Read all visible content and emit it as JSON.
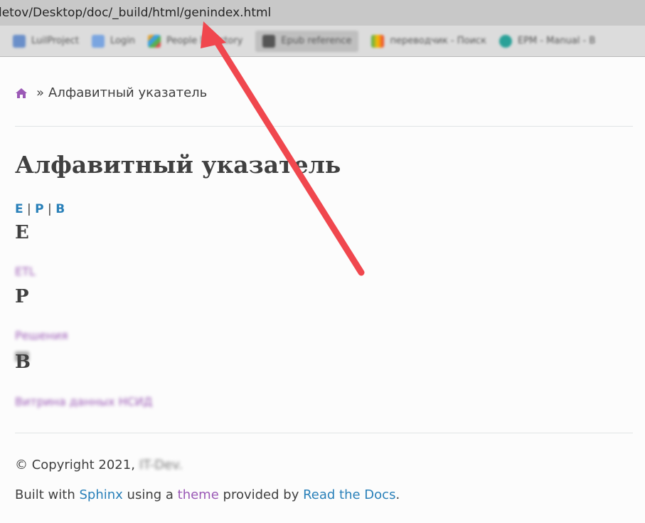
{
  "browser": {
    "url": "letov/Desktop/doc/_build/html/genindex.html",
    "bookmarks": [
      {
        "label": "LuilProject",
        "color": "#6a8fc9"
      },
      {
        "label": "Login",
        "color": "#7aa5e0"
      },
      {
        "label": "People Directory",
        "color": "#e0a030"
      },
      {
        "label": "Epub reference",
        "color": "#555555"
      },
      {
        "label": "переводчик - Поиск",
        "color": "#4caf50"
      },
      {
        "label": "EPM - Manual - B",
        "color": "#2aa198"
      }
    ]
  },
  "breadcrumb": {
    "home_icon": "home-icon",
    "separator": "»",
    "current": "Алфавитный указатель"
  },
  "page": {
    "title": "Алфавитный указатель",
    "jump_letters": [
      "Е",
      "Р",
      "В"
    ],
    "jump_separator": "|",
    "sections": [
      {
        "letter": "Е",
        "entry": "ETL"
      },
      {
        "letter": "Р",
        "entry": "Решения"
      },
      {
        "letter": "В",
        "entry": "Витрина данных НСИД"
      }
    ]
  },
  "footer": {
    "copyright": "© Copyright 2021,",
    "copyright_org": "IT-Dev.",
    "built_with": "Built with",
    "sphinx": "Sphinx",
    "using_a": "using a",
    "theme": "theme",
    "provided_by": "provided by",
    "rtd": "Read the Docs",
    "period": "."
  },
  "colors": {
    "link": "#2980b9",
    "visited": "#9b59b6",
    "annotation_arrow": "#f0474e"
  }
}
